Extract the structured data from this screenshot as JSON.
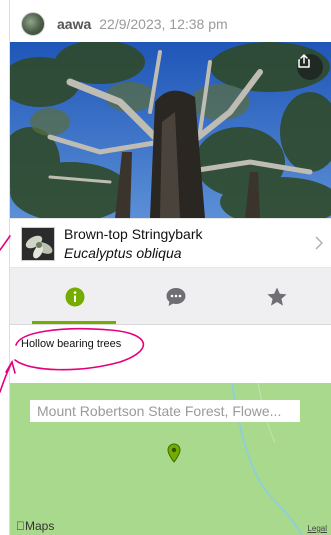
{
  "header": {
    "username": "aawa",
    "datetime": "22/9/2023, 12:38 pm"
  },
  "photo": {
    "share_icon": "share-icon"
  },
  "taxon": {
    "common_name": "Brown-top Stringybark",
    "scientific_name": "Eucalyptus obliqua",
    "chevron_icon": "chevron-right-icon"
  },
  "tabs": [
    {
      "name": "info",
      "icon": "info-icon",
      "active": true
    },
    {
      "name": "comments",
      "icon": "speech-bubble-icon",
      "active": false
    },
    {
      "name": "favorites",
      "icon": "star-icon",
      "active": false
    }
  ],
  "description": "Hollow bearing trees",
  "map": {
    "location_label": "Mount Robertson State Forest, Flowe...",
    "brand": "Maps",
    "legal": "Legal"
  },
  "colors": {
    "accent": "#74ac00",
    "map_bg": "#a9d98c",
    "annotation": "#e6007e"
  }
}
